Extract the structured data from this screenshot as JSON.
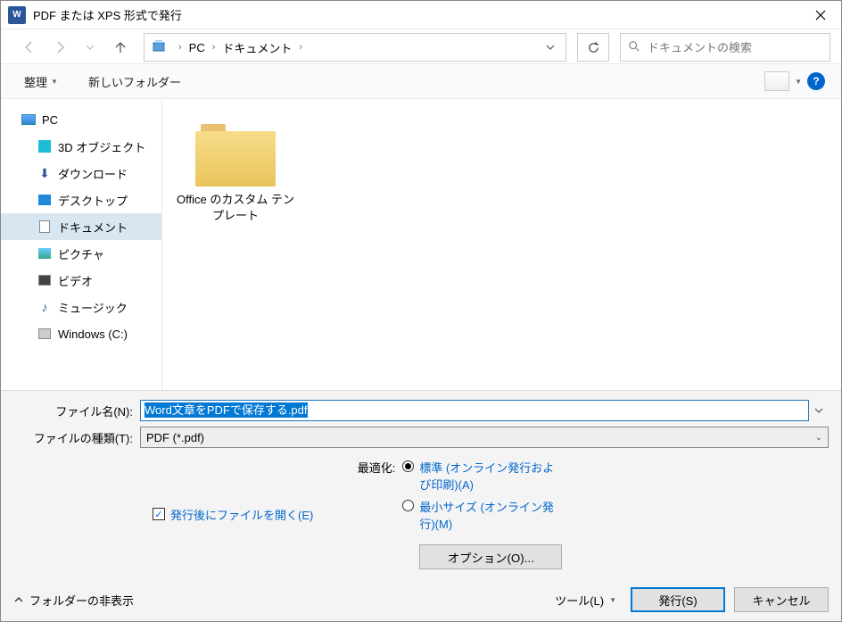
{
  "title": "PDF または XPS 形式で発行",
  "breadcrumb": {
    "pc": "PC",
    "docs": "ドキュメント"
  },
  "search": {
    "placeholder": "ドキュメントの検索"
  },
  "toolbar": {
    "organize": "整理",
    "newfolder": "新しいフォルダー"
  },
  "tree": {
    "pc": "PC",
    "obj3d": "3D オブジェクト",
    "downloads": "ダウンロード",
    "desktop": "デスクトップ",
    "documents": "ドキュメント",
    "pictures": "ピクチャ",
    "videos": "ビデオ",
    "music": "ミュージック",
    "cdrive": "Windows (C:)"
  },
  "content": {
    "folder1": "Office のカスタム テンプレート"
  },
  "form": {
    "fname_label": "ファイル名(N):",
    "fname_value": "Word文章をPDFで保存する.pdf",
    "ftype_label": "ファイルの種類(T):",
    "ftype_value": "PDF (*.pdf)",
    "openafter": "発行後にファイルを開く(E)",
    "optimize_label": "最適化:",
    "opt_standard": "標準 (オンライン発行および印刷)(A)",
    "opt_min": "最小サイズ (オンライン発行)(M)",
    "options_btn": "オプション(O)..."
  },
  "footer": {
    "hide": "フォルダーの非表示",
    "tools": "ツール(L)",
    "publish": "発行(S)",
    "cancel": "キャンセル"
  }
}
